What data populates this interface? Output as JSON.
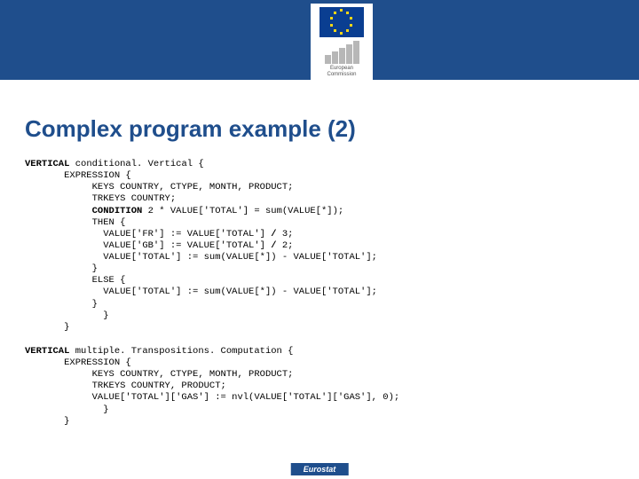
{
  "logo": {
    "line1": "European",
    "line2": "Commission"
  },
  "title": "Complex program example (2)",
  "code1": {
    "l01a": "VERTICAL",
    "l01b": " conditional. Vertical {",
    "l02a": "       EXPRESSION {",
    "l03a": "            KEYS COUNTRY, CTYPE, MONTH, PRODUCT;",
    "l04a": "            TRKEYS COUNTRY;",
    "l05a": "            ",
    "l05b": "CONDITION",
    "l05c": " 2 * VALUE['TOTAL'] = sum(VALUE[*]);",
    "l06a": "            THEN {",
    "l07a": "              VALUE['FR'] := VALUE['TOTAL'] ",
    "l07b": "/",
    "l07c": " 3;",
    "l08a": "              VALUE['GB'] := VALUE['TOTAL'] ",
    "l08b": "/",
    "l08c": " 2;",
    "l09a": "              VALUE['TOTAL'] := sum(VALUE[*]) - VALUE['TOTAL'];",
    "l10a": "            }",
    "l11a": "            ELSE {",
    "l12a": "              VALUE['TOTAL'] := sum(VALUE[*]) - VALUE['TOTAL'];",
    "l13a": "            }",
    "l14a": "              }",
    "l15a": "       }"
  },
  "code2": {
    "l01a": "VERTICAL",
    "l01b": " multiple. Transpositions. Computation {",
    "l02a": "       EXPRESSION {",
    "l03a": "            KEYS COUNTRY, CTYPE, MONTH, PRODUCT;",
    "l04a": "            TRKEYS COUNTRY, PRODUCT;",
    "l05a": "            VALUE['TOTAL']['GAS'] := nvl(VALUE['TOTAL']['GAS'], 0);",
    "l06a": "              }",
    "l07a": "       }"
  },
  "footer": "Eurostat"
}
